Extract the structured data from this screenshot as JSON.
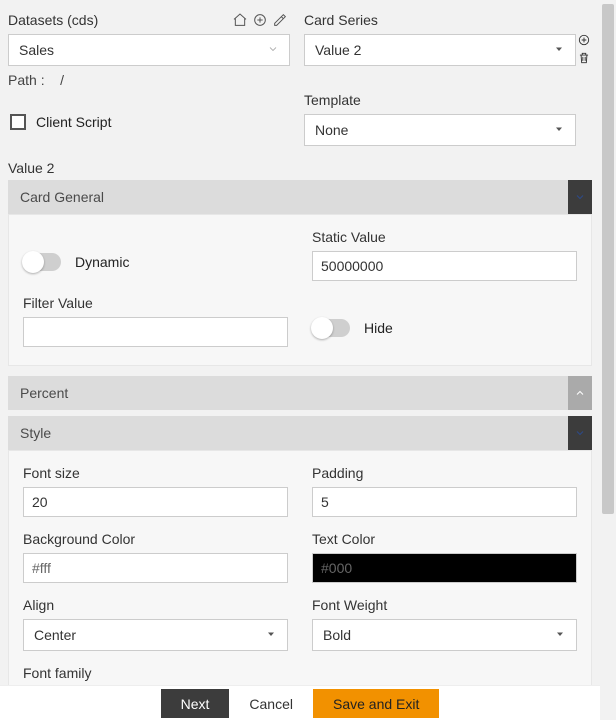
{
  "top": {
    "datasets_label": "Datasets (cds)",
    "datasets_value": "Sales",
    "path_label": "Path :",
    "path_value": "/",
    "client_script_label": "Client Script",
    "card_series_label": "Card Series",
    "card_series_value": "Value 2",
    "template_label": "Template",
    "template_value": "None"
  },
  "section_title": "Value 2",
  "card_general": {
    "header": "Card General",
    "dynamic_label": "Dynamic",
    "static_value_label": "Static Value",
    "static_value": "50000000",
    "filter_value_label": "Filter Value",
    "filter_value": "",
    "hide_label": "Hide"
  },
  "percent": {
    "header": "Percent"
  },
  "style": {
    "header": "Style",
    "font_size_label": "Font size",
    "font_size": "20",
    "padding_label": "Padding",
    "padding": "5",
    "bg_color_label": "Background Color",
    "bg_color": "#fff",
    "text_color_label": "Text Color",
    "text_color": "#000",
    "align_label": "Align",
    "align": "Center",
    "font_weight_label": "Font Weight",
    "font_weight": "Bold",
    "font_family_label": "Font family"
  },
  "footer": {
    "next": "Next",
    "cancel": "Cancel",
    "save_exit": "Save and Exit"
  }
}
